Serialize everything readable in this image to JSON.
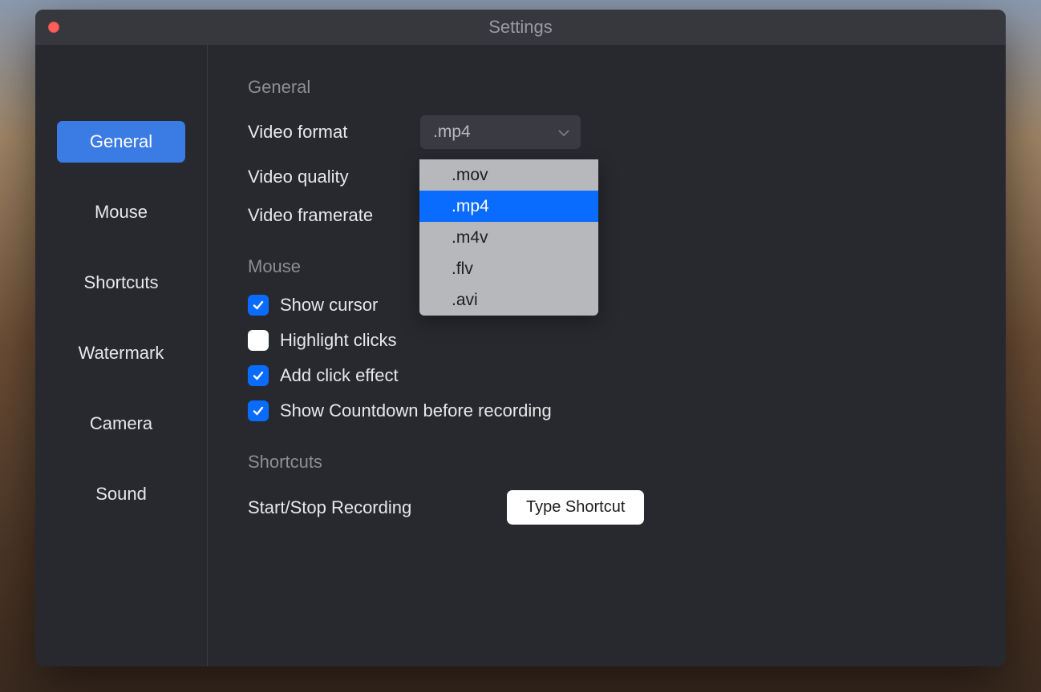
{
  "window": {
    "title": "Settings"
  },
  "sidebar": {
    "items": [
      {
        "label": "General",
        "active": true
      },
      {
        "label": "Mouse",
        "active": false
      },
      {
        "label": "Shortcuts",
        "active": false
      },
      {
        "label": "Watermark",
        "active": false
      },
      {
        "label": "Camera",
        "active": false
      },
      {
        "label": "Sound",
        "active": false
      }
    ]
  },
  "sections": {
    "general": {
      "header": "General",
      "video_format": {
        "label": "Video format",
        "value": ".mp4"
      },
      "video_quality": {
        "label": "Video quality"
      },
      "video_framerate": {
        "label": "Video framerate"
      }
    },
    "mouse": {
      "header": "Mouse",
      "show_cursor": {
        "label": "Show cursor",
        "checked": true
      },
      "highlight_clicks": {
        "label": "Highlight clicks",
        "checked": false
      },
      "add_click_effect": {
        "label": "Add click effect",
        "checked": true
      },
      "show_countdown": {
        "label": "Show Countdown before recording",
        "checked": true
      }
    },
    "shortcuts": {
      "header": "Shortcuts",
      "start_stop": {
        "label": "Start/Stop Recording",
        "button": "Type Shortcut"
      }
    }
  },
  "dropdown": {
    "options": [
      {
        "label": ".mov",
        "selected": false
      },
      {
        "label": ".mp4",
        "selected": true
      },
      {
        "label": ".m4v",
        "selected": false
      },
      {
        "label": ".flv",
        "selected": false
      },
      {
        "label": ".avi",
        "selected": false
      }
    ]
  }
}
